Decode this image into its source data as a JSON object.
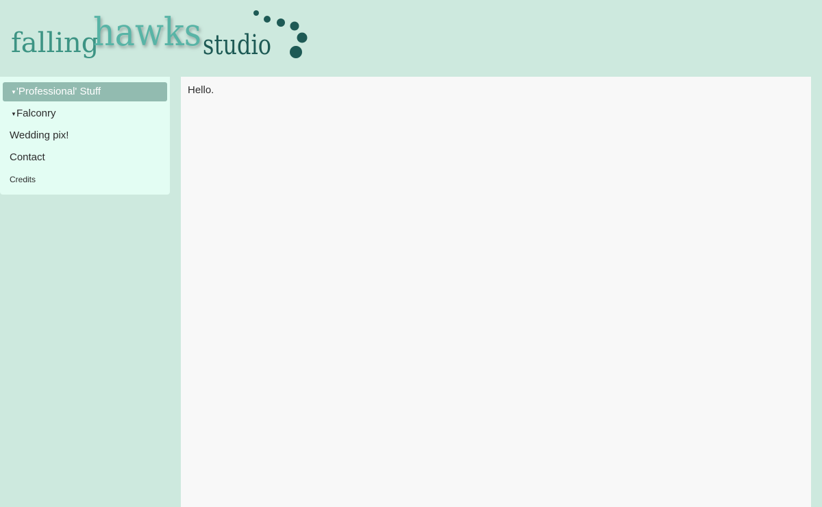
{
  "logo": {
    "part1": "falling",
    "part2": "hawks",
    "part3": "studio",
    "colors": {
      "falling": "#3d9484",
      "hawks": "#58b4a6",
      "studio": "#1e5a55",
      "dots": "#1e5a55"
    }
  },
  "nav": {
    "items": [
      {
        "label": "'Professional' Stuff",
        "expandable": true,
        "active": true
      },
      {
        "label": "Falconry",
        "expandable": true,
        "active": false
      },
      {
        "label": "Wedding pix!",
        "expandable": false,
        "active": false
      },
      {
        "label": "Contact",
        "expandable": false,
        "active": false
      },
      {
        "label": "Credits",
        "expandable": false,
        "active": false
      }
    ],
    "caret": "▼",
    "active_bg": "#92bbb0"
  },
  "content": {
    "text": "Hello."
  }
}
